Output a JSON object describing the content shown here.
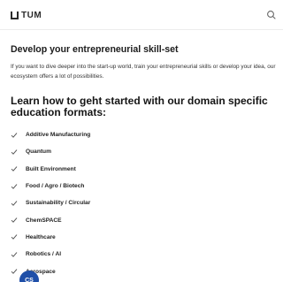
{
  "header": {
    "logo_text": "TUM",
    "search_icon": "search-icon"
  },
  "main": {
    "section_title": "Develop your entrepreneurial skill-set",
    "intro": "If you want to dive deeper into the start-up world, train your entrepreneurial skills or develop your idea, our ecosystem offers a lot of possibilities.",
    "formats_heading": "Learn how to geht started with our domain specific education formats:",
    "formats": [
      {
        "label": "Additive Manufacturing"
      },
      {
        "label": "Quantum"
      },
      {
        "label": "Built Environment"
      },
      {
        "label": "Food / Agro / Biotech"
      },
      {
        "label": "Sustainability / Circular"
      },
      {
        "label": "ChemSPACE"
      },
      {
        "label": "Healthcare"
      },
      {
        "label": "Robotics / AI"
      },
      {
        "label": "Aerospace"
      }
    ],
    "check_icon": "check-icon"
  },
  "chat_badge": {
    "label": "CS"
  }
}
